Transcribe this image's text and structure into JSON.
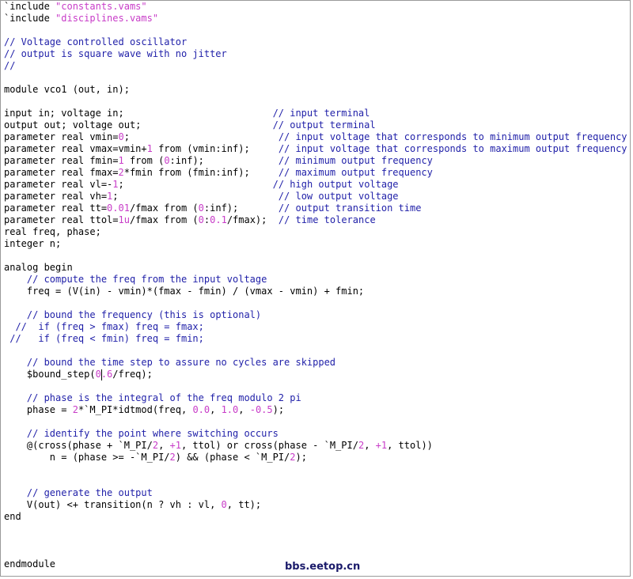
{
  "editor": {
    "colors": {
      "comment": "#1f1fa8",
      "string": "#c83cc8",
      "number": "#c83cc8",
      "plain": "#000000",
      "background": "#ffffff"
    },
    "caret": {
      "line": 31,
      "column": 17
    },
    "lines": [
      [
        {
          "t": "`include ",
          "c": "plain"
        },
        {
          "t": "\"constants.vams\"",
          "c": "string"
        }
      ],
      [
        {
          "t": "`include ",
          "c": "plain"
        },
        {
          "t": "\"disciplines.vams\"",
          "c": "string"
        }
      ],
      [],
      [
        {
          "t": "// Voltage controlled oscillator",
          "c": "comment"
        }
      ],
      [
        {
          "t": "// output is square wave with no jitter",
          "c": "comment"
        }
      ],
      [
        {
          "t": "//",
          "c": "comment"
        }
      ],
      [],
      [
        {
          "t": "module vco1 (out, in);",
          "c": "plain"
        }
      ],
      [],
      [
        {
          "t": "input in; voltage in;                          ",
          "c": "plain"
        },
        {
          "t": "// input terminal",
          "c": "comment"
        }
      ],
      [
        {
          "t": "output out; voltage out;                       ",
          "c": "plain"
        },
        {
          "t": "// output terminal",
          "c": "comment"
        }
      ],
      [
        {
          "t": "parameter real vmin=",
          "c": "plain"
        },
        {
          "t": "0",
          "c": "number"
        },
        {
          "t": ";                          ",
          "c": "plain"
        },
        {
          "t": "// input voltage that corresponds to minimum output frequency",
          "c": "comment"
        }
      ],
      [
        {
          "t": "parameter real vmax=vmin+",
          "c": "plain"
        },
        {
          "t": "1",
          "c": "number"
        },
        {
          "t": " from (vmin:inf);     ",
          "c": "plain"
        },
        {
          "t": "// input voltage that corresponds to maximum output frequency",
          "c": "comment"
        }
      ],
      [
        {
          "t": "parameter real fmin=",
          "c": "plain"
        },
        {
          "t": "1",
          "c": "number"
        },
        {
          "t": " from (",
          "c": "plain"
        },
        {
          "t": "0",
          "c": "number"
        },
        {
          "t": ":inf);             ",
          "c": "plain"
        },
        {
          "t": "// minimum output frequency",
          "c": "comment"
        }
      ],
      [
        {
          "t": "parameter real fmax=",
          "c": "plain"
        },
        {
          "t": "2",
          "c": "number"
        },
        {
          "t": "*fmin from (fmin:inf);     ",
          "c": "plain"
        },
        {
          "t": "// maximum output frequency",
          "c": "comment"
        }
      ],
      [
        {
          "t": "parameter real vl=-",
          "c": "plain"
        },
        {
          "t": "1",
          "c": "number"
        },
        {
          "t": ";                          ",
          "c": "plain"
        },
        {
          "t": "// high output voltage",
          "c": "comment"
        }
      ],
      [
        {
          "t": "parameter real vh=",
          "c": "plain"
        },
        {
          "t": "1",
          "c": "number"
        },
        {
          "t": ";                            ",
          "c": "plain"
        },
        {
          "t": "// low output voltage",
          "c": "comment"
        }
      ],
      [
        {
          "t": "parameter real tt=",
          "c": "plain"
        },
        {
          "t": "0.01",
          "c": "number"
        },
        {
          "t": "/fmax from (",
          "c": "plain"
        },
        {
          "t": "0",
          "c": "number"
        },
        {
          "t": ":inf);       ",
          "c": "plain"
        },
        {
          "t": "// output transition time",
          "c": "comment"
        }
      ],
      [
        {
          "t": "parameter real ttol=",
          "c": "plain"
        },
        {
          "t": "1u",
          "c": "number"
        },
        {
          "t": "/fmax from (",
          "c": "plain"
        },
        {
          "t": "0",
          "c": "number"
        },
        {
          "t": ":",
          "c": "plain"
        },
        {
          "t": "0.1",
          "c": "number"
        },
        {
          "t": "/fmax);  ",
          "c": "plain"
        },
        {
          "t": "// time tolerance",
          "c": "comment"
        }
      ],
      [
        {
          "t": "real freq, phase;",
          "c": "plain"
        }
      ],
      [
        {
          "t": "integer n;",
          "c": "plain"
        }
      ],
      [],
      [
        {
          "t": "analog begin",
          "c": "plain"
        }
      ],
      [
        {
          "t": "    ",
          "c": "plain"
        },
        {
          "t": "// compute the freq from the input voltage",
          "c": "comment"
        }
      ],
      [
        {
          "t": "    freq = (V(in) - vmin)*(fmax - fmin) / (vmax - vmin) + fmin;",
          "c": "plain"
        }
      ],
      [],
      [
        {
          "t": "    ",
          "c": "plain"
        },
        {
          "t": "// bound the frequency (this is optional)",
          "c": "comment"
        }
      ],
      [
        {
          "t": "  ",
          "c": "plain"
        },
        {
          "t": "//  if (freq > fmax) freq = fmax;",
          "c": "comment"
        }
      ],
      [
        {
          "t": " ",
          "c": "plain"
        },
        {
          "t": "//   if (freq < fmin) freq = fmin;",
          "c": "comment"
        }
      ],
      [],
      [
        {
          "t": "    ",
          "c": "plain"
        },
        {
          "t": "// bound the time step to assure no cycles are skipped",
          "c": "comment"
        }
      ],
      [
        {
          "t": "    $bound_step(",
          "c": "plain"
        },
        {
          "t": "0.6",
          "c": "number"
        },
        {
          "t": "/freq);",
          "c": "plain"
        }
      ],
      [],
      [
        {
          "t": "    ",
          "c": "plain"
        },
        {
          "t": "// phase is the integral of the freq modulo 2 pi",
          "c": "comment"
        }
      ],
      [
        {
          "t": "    phase = ",
          "c": "plain"
        },
        {
          "t": "2",
          "c": "number"
        },
        {
          "t": "*`M_PI*idtmod(freq, ",
          "c": "plain"
        },
        {
          "t": "0.0",
          "c": "number"
        },
        {
          "t": ", ",
          "c": "plain"
        },
        {
          "t": "1.0",
          "c": "number"
        },
        {
          "t": ", ",
          "c": "plain"
        },
        {
          "t": "-0.5",
          "c": "number"
        },
        {
          "t": ");",
          "c": "plain"
        }
      ],
      [],
      [
        {
          "t": "    ",
          "c": "plain"
        },
        {
          "t": "// identify the point where switching occurs",
          "c": "comment"
        }
      ],
      [
        {
          "t": "    @(cross(phase + `M_PI/",
          "c": "plain"
        },
        {
          "t": "2",
          "c": "number"
        },
        {
          "t": ", ",
          "c": "plain"
        },
        {
          "t": "+1",
          "c": "number"
        },
        {
          "t": ", ttol) or cross(phase - `M_PI/",
          "c": "plain"
        },
        {
          "t": "2",
          "c": "number"
        },
        {
          "t": ", ",
          "c": "plain"
        },
        {
          "t": "+1",
          "c": "number"
        },
        {
          "t": ", ttol))",
          "c": "plain"
        }
      ],
      [
        {
          "t": "        n = (phase >= -`M_PI/",
          "c": "plain"
        },
        {
          "t": "2",
          "c": "number"
        },
        {
          "t": ") && (phase < `M_PI/",
          "c": "plain"
        },
        {
          "t": "2",
          "c": "number"
        },
        {
          "t": ");",
          "c": "plain"
        }
      ],
      [],
      [],
      [
        {
          "t": "    ",
          "c": "plain"
        },
        {
          "t": "// generate the output",
          "c": "comment"
        }
      ],
      [
        {
          "t": "    V(out) <+ transition(n ? vh : vl, ",
          "c": "plain"
        },
        {
          "t": "0",
          "c": "number"
        },
        {
          "t": ", tt);",
          "c": "plain"
        }
      ],
      [
        {
          "t": "end",
          "c": "plain"
        }
      ],
      [],
      [],
      [],
      [
        {
          "t": "endmodule",
          "c": "plain"
        }
      ]
    ]
  },
  "watermark": {
    "text": "bbs.eetop.cn"
  }
}
